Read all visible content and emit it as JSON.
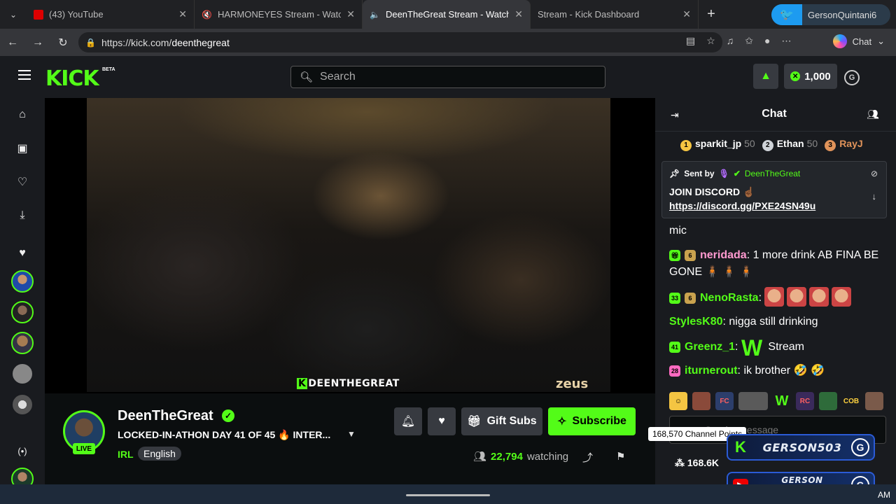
{
  "browser": {
    "tabs": [
      {
        "label": "(43) YouTube",
        "favicon": "youtube-icon"
      },
      {
        "label": "HARMONEYES Stream - Watch",
        "favicon": "kick-icon",
        "muted": true
      },
      {
        "label": "DeenTheGreat Stream - Watch",
        "favicon": "kick-icon",
        "active": true
      },
      {
        "label": "Stream - Kick Dashboard",
        "favicon": "kick-icon"
      }
    ],
    "profile_name": "GersonQuintani6",
    "url_host": "https://kick.com/",
    "url_path": "deenthegreat",
    "chat_label": "Chat"
  },
  "kick": {
    "logo": "KICK",
    "beta": "BETA",
    "search_placeholder": "Search",
    "points": "1,000"
  },
  "channel": {
    "name": "DeenTheGreat",
    "title": "LOCKED-IN-ATHON DAY 41 OF 45 🔥 INTER...",
    "category": "IRL",
    "language": "English",
    "live_label": "LIVE",
    "viewers": "22,794",
    "viewers_label": "watching",
    "gift_label": "Gift Subs",
    "subscribe_label": "Subscribe",
    "watermark_left": "DEENTHEGREAT",
    "watermark_right": "zeus"
  },
  "chat": {
    "title": "Chat",
    "leaderboard": [
      {
        "rank": "1",
        "name": "sparkit_jp",
        "points": "50",
        "color": "#f5c542"
      },
      {
        "rank": "2",
        "name": "Ethan",
        "points": "50",
        "color": "#cfd3d8"
      },
      {
        "rank": "3",
        "name": "RayJ",
        "points": "",
        "color": "#e0935a"
      }
    ],
    "pinned": {
      "sent_by": "Sent by",
      "author": "DeenTheGreat",
      "text": "JOIN DISCORD ☝🏾",
      "link": "https://discord.gg/PXE24SN49u"
    },
    "messages": [
      {
        "user": "",
        "text": "mic",
        "color": "#ffffff"
      },
      {
        "user": "neridada",
        "text": "1 more drink AB FINA BE GONE 🧍🏾 🧍🏾 🧍🏾",
        "color": "#ff9ad0"
      },
      {
        "user": "NenoRasta",
        "text": "",
        "color": "#53fc18",
        "badge": "33"
      },
      {
        "user": "StylesK80",
        "text": "nigga still drinking",
        "color": "#53fc18"
      },
      {
        "user": "Greenz_1",
        "text": "Stream",
        "color": "#53fc18",
        "badge": "41"
      },
      {
        "user": "iturnerout",
        "text": "ik brother 🤣 🤣",
        "color": "#53fc18",
        "badge": "28"
      }
    ],
    "input_placeholder": "Send a message",
    "channel_points": "168.6K",
    "tooltip": "168,570 Channel Points"
  },
  "overlays": {
    "kick_handle": "GERSON503",
    "youtube_handle": "GERSON QUINTANILLA"
  },
  "taskbar": {
    "clock": "AM"
  }
}
